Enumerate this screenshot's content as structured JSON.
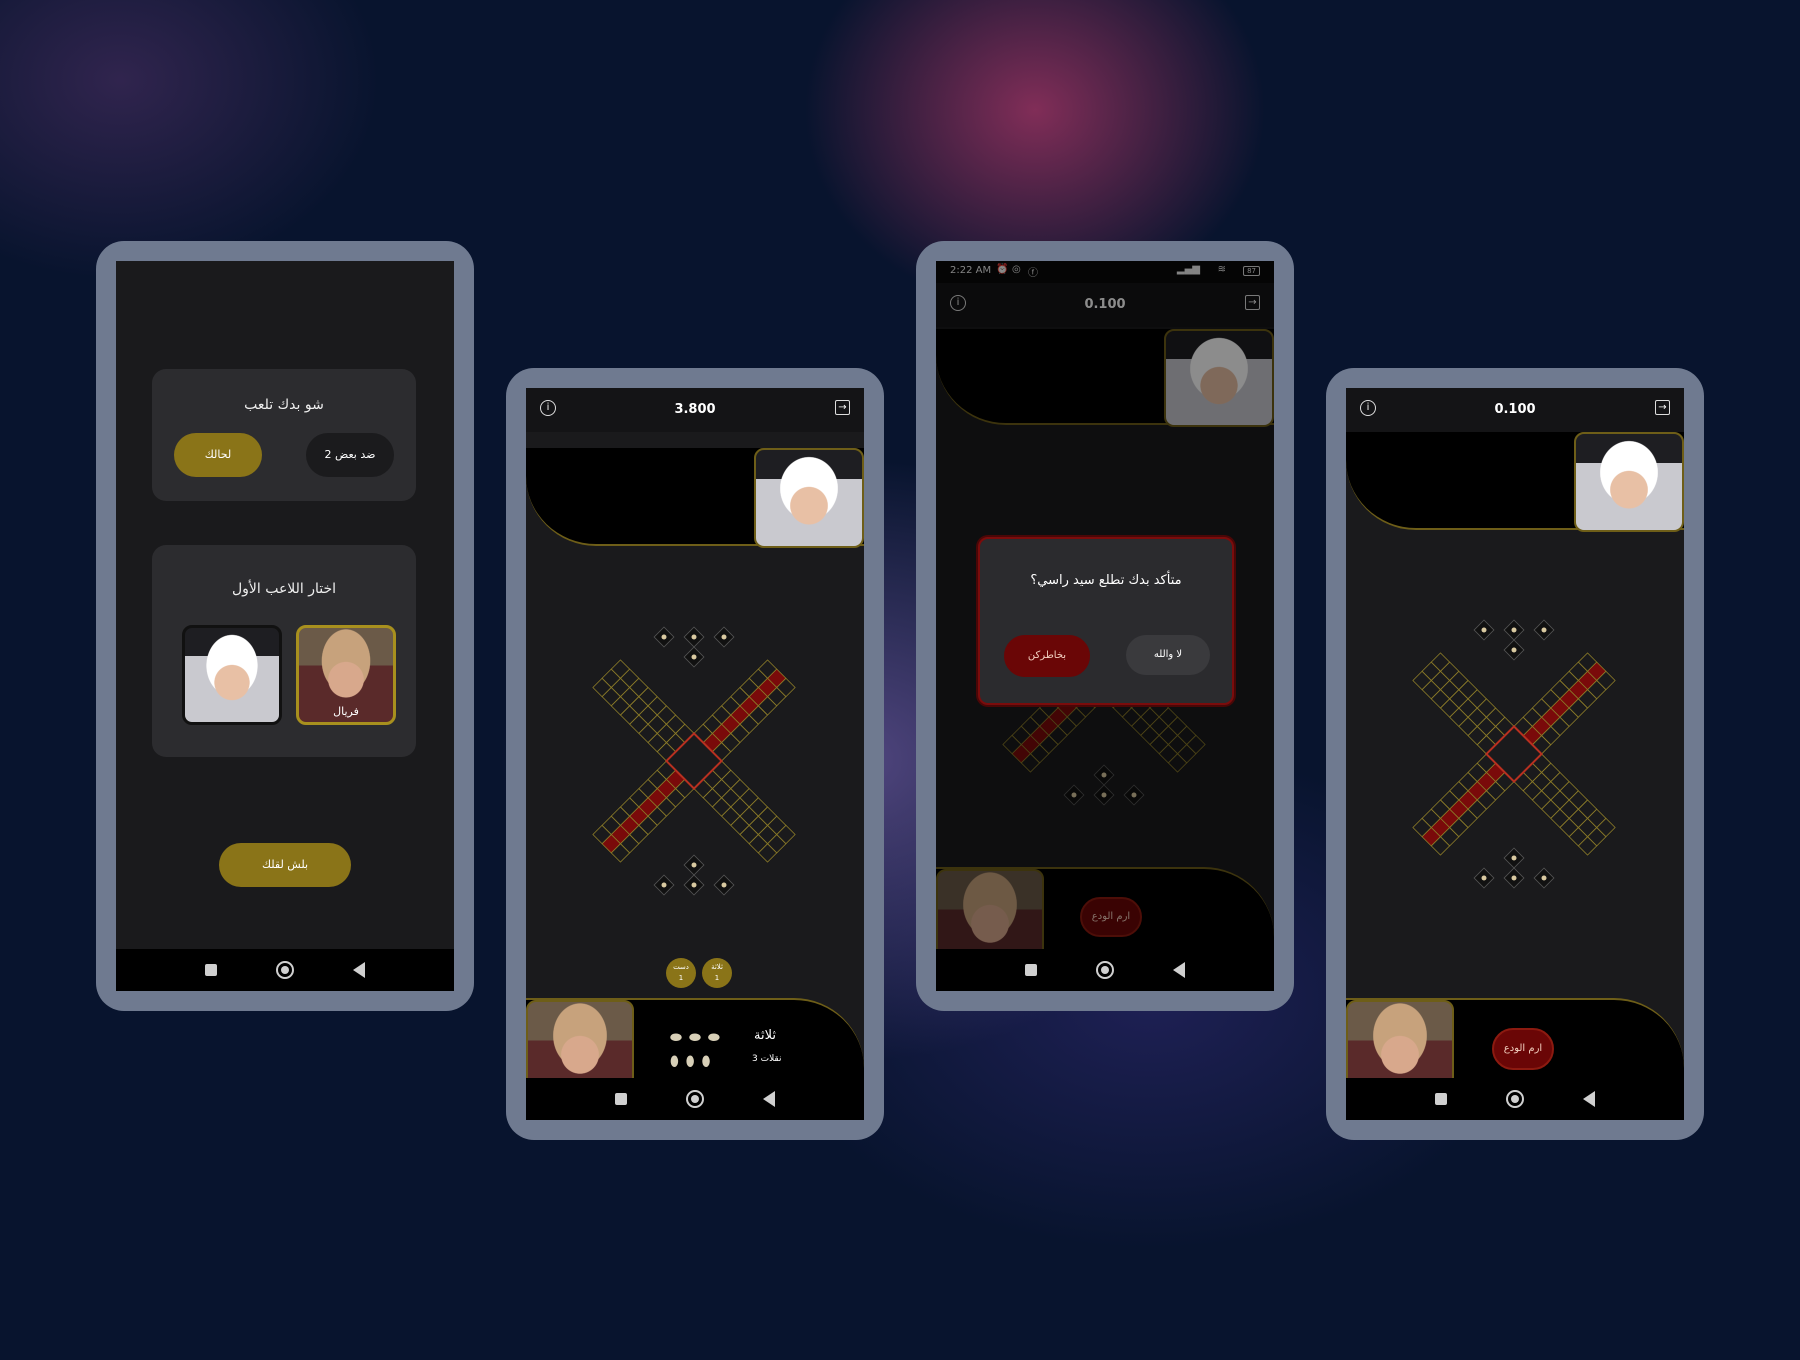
{
  "phone1": {
    "what_to_play": "شو بدك تلعب",
    "mode_solo": "لحالك",
    "mode_versus": "2 ضد بعض",
    "choose_first_player": "اختار اللاعب الأول",
    "player_name": "فريال",
    "start_button": "بلش لقلك"
  },
  "phone2": {
    "score": "3.800",
    "badge_left_title": "دست",
    "badge_left_count": "1",
    "badge_right_title": "ثلاثة",
    "badge_right_count": "1",
    "throw_result": "ثلاثة",
    "moves": "3 نقلات"
  },
  "phone3": {
    "status_time": "2:22 AM",
    "battery": "87",
    "score": "0.100",
    "dialog_question": "متأكد بدك تطلع سيد راسي؟",
    "confirm_button": "بخاطركن",
    "cancel_button": "لا والله",
    "throw_button": "ارم الودع"
  },
  "phone4": {
    "score": "0.100",
    "throw_button": "ارم الودع"
  },
  "icons": [
    "info-icon",
    "exit-icon",
    "square-nav-icon",
    "home-nav-icon",
    "back-nav-icon",
    "pawn-icon",
    "cowrie-shell-icon",
    "alarm-icon",
    "whatsapp-icon",
    "facebook-icon",
    "signal-icon",
    "wifi-icon",
    "battery-icon"
  ],
  "colors": {
    "gold": "#8a7418",
    "board_line": "#8a7a28",
    "board_red": "#7a0a0a",
    "dialog_red": "#6a0606"
  }
}
